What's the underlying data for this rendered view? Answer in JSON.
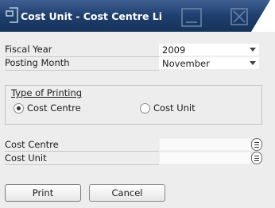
{
  "window": {
    "title": "Cost Unit - Cost Centre Li",
    "accent": "#1e3f6e"
  },
  "fields": {
    "fiscal_year_label": "Fiscal Year",
    "fiscal_year_value": "2009",
    "posting_month_label": "Posting Month",
    "posting_month_value": "November"
  },
  "type_of_printing": {
    "title": "Type of Printing",
    "options": [
      {
        "label": "Cost Centre",
        "selected": true
      },
      {
        "label": "Cost Unit",
        "selected": false
      }
    ]
  },
  "selection": {
    "cost_centre_label": "Cost Centre",
    "cost_centre_value": "",
    "cost_unit_label": "Cost Unit",
    "cost_unit_value": ""
  },
  "buttons": {
    "print": "Print",
    "cancel": "Cancel"
  },
  "icons": {
    "window_icon": "window-icon",
    "minimize": "minimize-icon",
    "close": "close-icon",
    "list_picker": "list-icon"
  }
}
